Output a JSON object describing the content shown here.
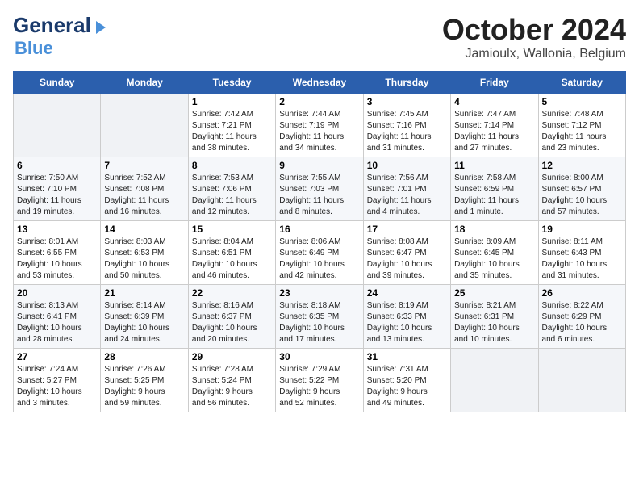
{
  "header": {
    "logo_line1": "General",
    "logo_line2": "Blue",
    "month": "October 2024",
    "location": "Jamioulx, Wallonia, Belgium"
  },
  "weekdays": [
    "Sunday",
    "Monday",
    "Tuesday",
    "Wednesday",
    "Thursday",
    "Friday",
    "Saturday"
  ],
  "weeks": [
    [
      {
        "day": "",
        "info": ""
      },
      {
        "day": "",
        "info": ""
      },
      {
        "day": "1",
        "info": "Sunrise: 7:42 AM\nSunset: 7:21 PM\nDaylight: 11 hours\nand 38 minutes."
      },
      {
        "day": "2",
        "info": "Sunrise: 7:44 AM\nSunset: 7:19 PM\nDaylight: 11 hours\nand 34 minutes."
      },
      {
        "day": "3",
        "info": "Sunrise: 7:45 AM\nSunset: 7:16 PM\nDaylight: 11 hours\nand 31 minutes."
      },
      {
        "day": "4",
        "info": "Sunrise: 7:47 AM\nSunset: 7:14 PM\nDaylight: 11 hours\nand 27 minutes."
      },
      {
        "day": "5",
        "info": "Sunrise: 7:48 AM\nSunset: 7:12 PM\nDaylight: 11 hours\nand 23 minutes."
      }
    ],
    [
      {
        "day": "6",
        "info": "Sunrise: 7:50 AM\nSunset: 7:10 PM\nDaylight: 11 hours\nand 19 minutes."
      },
      {
        "day": "7",
        "info": "Sunrise: 7:52 AM\nSunset: 7:08 PM\nDaylight: 11 hours\nand 16 minutes."
      },
      {
        "day": "8",
        "info": "Sunrise: 7:53 AM\nSunset: 7:06 PM\nDaylight: 11 hours\nand 12 minutes."
      },
      {
        "day": "9",
        "info": "Sunrise: 7:55 AM\nSunset: 7:03 PM\nDaylight: 11 hours\nand 8 minutes."
      },
      {
        "day": "10",
        "info": "Sunrise: 7:56 AM\nSunset: 7:01 PM\nDaylight: 11 hours\nand 4 minutes."
      },
      {
        "day": "11",
        "info": "Sunrise: 7:58 AM\nSunset: 6:59 PM\nDaylight: 11 hours\nand 1 minute."
      },
      {
        "day": "12",
        "info": "Sunrise: 8:00 AM\nSunset: 6:57 PM\nDaylight: 10 hours\nand 57 minutes."
      }
    ],
    [
      {
        "day": "13",
        "info": "Sunrise: 8:01 AM\nSunset: 6:55 PM\nDaylight: 10 hours\nand 53 minutes."
      },
      {
        "day": "14",
        "info": "Sunrise: 8:03 AM\nSunset: 6:53 PM\nDaylight: 10 hours\nand 50 minutes."
      },
      {
        "day": "15",
        "info": "Sunrise: 8:04 AM\nSunset: 6:51 PM\nDaylight: 10 hours\nand 46 minutes."
      },
      {
        "day": "16",
        "info": "Sunrise: 8:06 AM\nSunset: 6:49 PM\nDaylight: 10 hours\nand 42 minutes."
      },
      {
        "day": "17",
        "info": "Sunrise: 8:08 AM\nSunset: 6:47 PM\nDaylight: 10 hours\nand 39 minutes."
      },
      {
        "day": "18",
        "info": "Sunrise: 8:09 AM\nSunset: 6:45 PM\nDaylight: 10 hours\nand 35 minutes."
      },
      {
        "day": "19",
        "info": "Sunrise: 8:11 AM\nSunset: 6:43 PM\nDaylight: 10 hours\nand 31 minutes."
      }
    ],
    [
      {
        "day": "20",
        "info": "Sunrise: 8:13 AM\nSunset: 6:41 PM\nDaylight: 10 hours\nand 28 minutes."
      },
      {
        "day": "21",
        "info": "Sunrise: 8:14 AM\nSunset: 6:39 PM\nDaylight: 10 hours\nand 24 minutes."
      },
      {
        "day": "22",
        "info": "Sunrise: 8:16 AM\nSunset: 6:37 PM\nDaylight: 10 hours\nand 20 minutes."
      },
      {
        "day": "23",
        "info": "Sunrise: 8:18 AM\nSunset: 6:35 PM\nDaylight: 10 hours\nand 17 minutes."
      },
      {
        "day": "24",
        "info": "Sunrise: 8:19 AM\nSunset: 6:33 PM\nDaylight: 10 hours\nand 13 minutes."
      },
      {
        "day": "25",
        "info": "Sunrise: 8:21 AM\nSunset: 6:31 PM\nDaylight: 10 hours\nand 10 minutes."
      },
      {
        "day": "26",
        "info": "Sunrise: 8:22 AM\nSunset: 6:29 PM\nDaylight: 10 hours\nand 6 minutes."
      }
    ],
    [
      {
        "day": "27",
        "info": "Sunrise: 7:24 AM\nSunset: 5:27 PM\nDaylight: 10 hours\nand 3 minutes."
      },
      {
        "day": "28",
        "info": "Sunrise: 7:26 AM\nSunset: 5:25 PM\nDaylight: 9 hours\nand 59 minutes."
      },
      {
        "day": "29",
        "info": "Sunrise: 7:28 AM\nSunset: 5:24 PM\nDaylight: 9 hours\nand 56 minutes."
      },
      {
        "day": "30",
        "info": "Sunrise: 7:29 AM\nSunset: 5:22 PM\nDaylight: 9 hours\nand 52 minutes."
      },
      {
        "day": "31",
        "info": "Sunrise: 7:31 AM\nSunset: 5:20 PM\nDaylight: 9 hours\nand 49 minutes."
      },
      {
        "day": "",
        "info": ""
      },
      {
        "day": "",
        "info": ""
      }
    ]
  ]
}
